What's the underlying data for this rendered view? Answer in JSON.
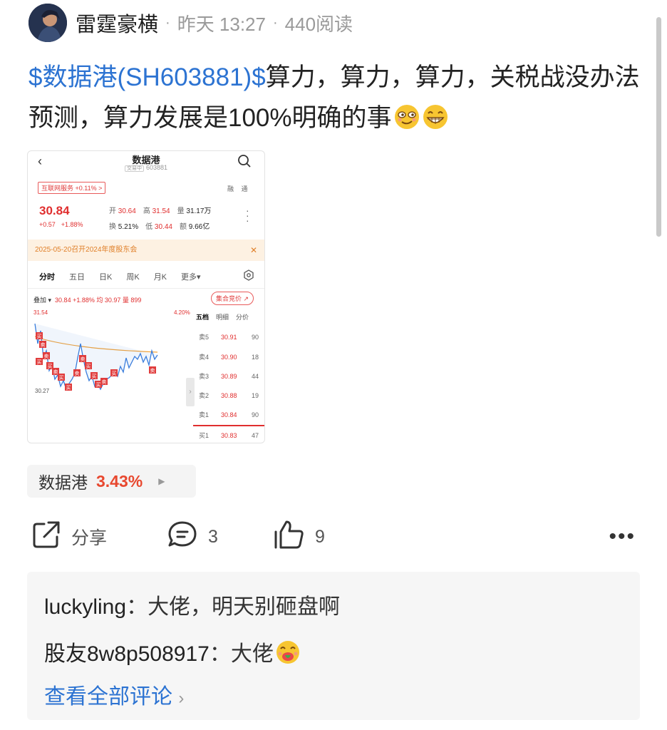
{
  "post": {
    "author": "雷霆豪横",
    "time": "昨天 13:27",
    "reads": "440阅读",
    "stock_tag": "$数据港(SH603881)$",
    "text": "算力，算力，算力，关税战没办法预测，算力发展是100%明确的事"
  },
  "screenshot": {
    "title": "数据港",
    "status_tag": "交易中",
    "code": "603881",
    "sector": "互联网服务 +0.11% >",
    "rong": "融 通",
    "price": "30.84",
    "change": "+0.57",
    "change_pct": "+1.88%",
    "open_label": "开",
    "open": "30.64",
    "high_label": "高",
    "high": "31.54",
    "vol_label": "量",
    "vol": "31.17万",
    "turnover_label": "换",
    "turnover": "5.21%",
    "low_label": "低",
    "low": "30.44",
    "amount_label": "额",
    "amount": "9.66亿",
    "notice": "2025-05-20召开2024年度股东会",
    "tabs": [
      "分时",
      "五日",
      "日K",
      "周K",
      "月K",
      "更多▾"
    ],
    "overlay_label": "叠加 ▾",
    "overlay_values": "30.84 +1.88% 均 30.97 量 899",
    "auction": "集合竞价 ↗",
    "chart_high": "31.54",
    "chart_low": "30.27",
    "chart_pct": "4.20%",
    "book_tabs": [
      "五档",
      "明细",
      "分价"
    ],
    "book": [
      {
        "name": "卖5",
        "price": "30.91",
        "vol": "90"
      },
      {
        "name": "卖4",
        "price": "30.90",
        "vol": "18"
      },
      {
        "name": "卖3",
        "price": "30.89",
        "vol": "44"
      },
      {
        "name": "卖2",
        "price": "30.88",
        "vol": "19"
      },
      {
        "name": "卖1",
        "price": "30.84",
        "vol": "90"
      },
      {
        "name": "买1",
        "price": "30.83",
        "vol": "47"
      }
    ],
    "trade_marks": [
      "买",
      "卖"
    ]
  },
  "chip": {
    "name": "数据港",
    "pct": "3.43%"
  },
  "actions": {
    "share": "分享",
    "comments": "3",
    "likes": "9"
  },
  "comments": [
    {
      "user": "luckyling",
      "sep": "：",
      "text": "大佬，明天别砸盘啊"
    },
    {
      "user": "股友8w8p508917",
      "sep": "：",
      "text": "大佬"
    }
  ],
  "view_all": "查看全部评论",
  "colors": {
    "link": "#2c73d2",
    "up": "#e02e2e",
    "chip_up": "#e8482f"
  }
}
